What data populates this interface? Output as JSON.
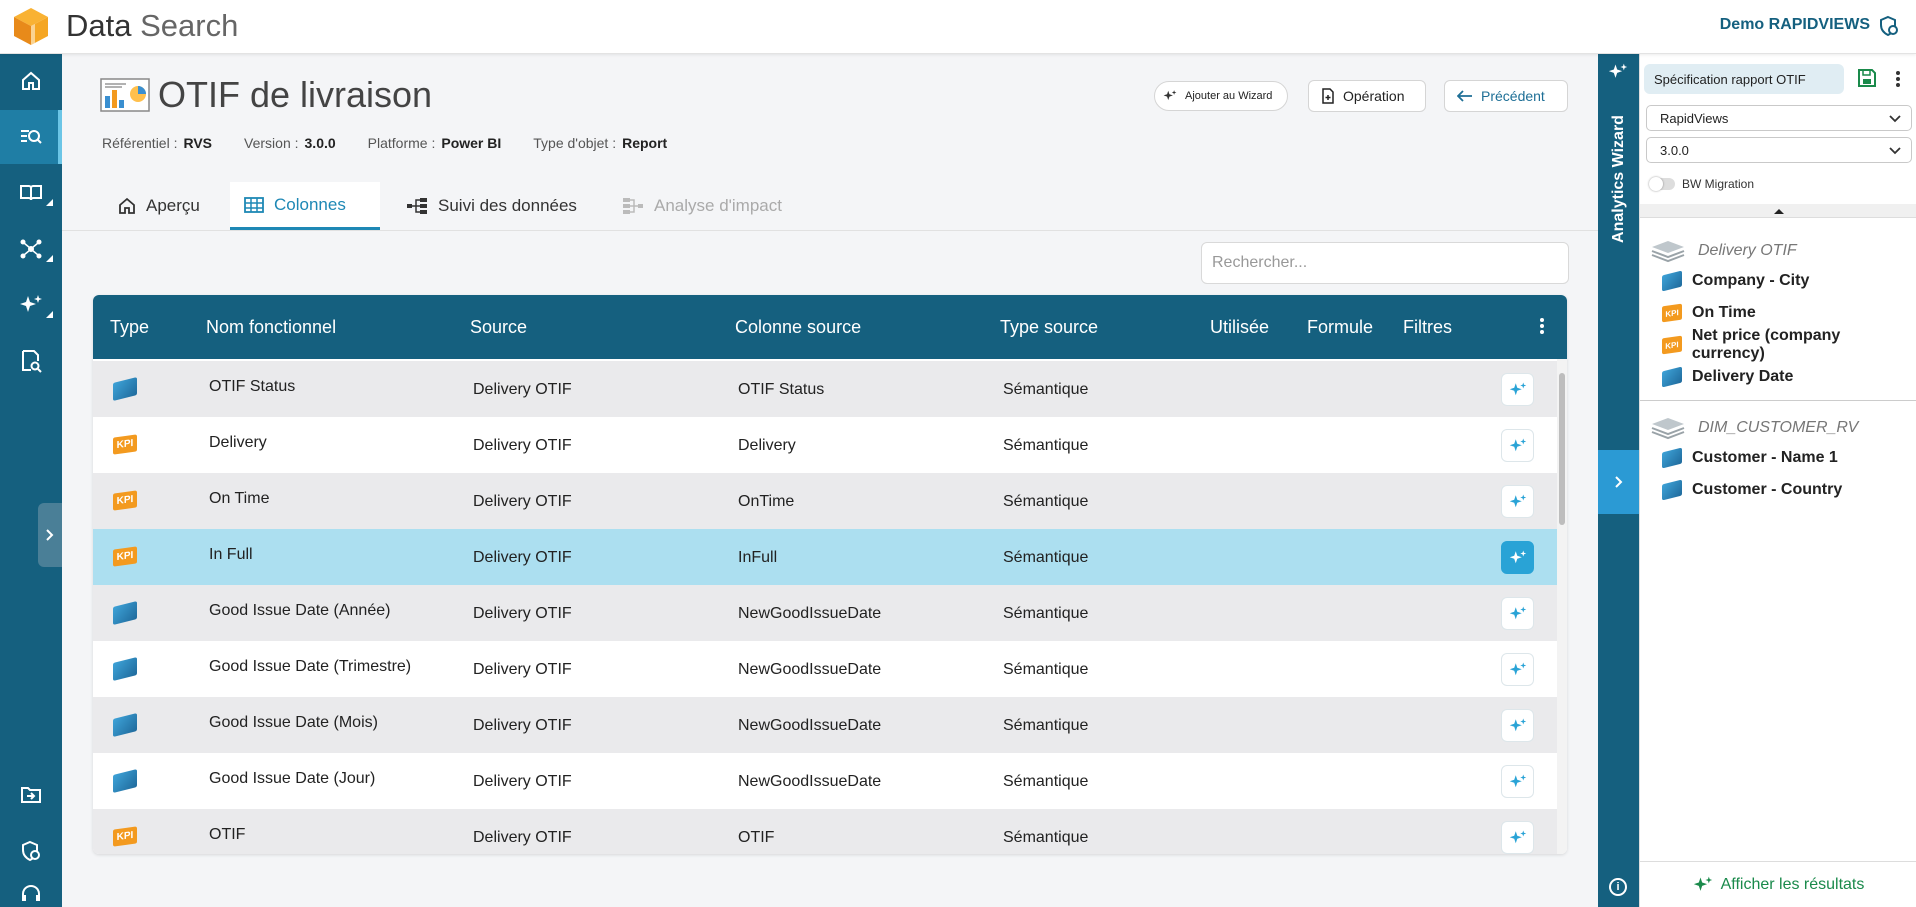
{
  "app": {
    "title_part1": "Data",
    "title_part2": "Search",
    "user": "Demo RAPIDVIEWS"
  },
  "nav": {
    "items": [
      "home-icon",
      "search-list-icon",
      "book-icon",
      "network-icon",
      "sparkle-icon",
      "report-search-icon"
    ],
    "bottom_items": [
      "import-icon",
      "shield-user-icon",
      "support-icon"
    ]
  },
  "header": {
    "title": "OTIF de livraison",
    "meta": [
      {
        "label": "Référentiel :",
        "value": "RVS"
      },
      {
        "label": "Version :",
        "value": "3.0.0"
      },
      {
        "label": "Platforme :",
        "value": "Power BI"
      },
      {
        "label": "Type d'objet :",
        "value": "Report"
      }
    ],
    "add_wizard_label": "Ajouter au Wizard",
    "operation_label": "Opération",
    "prev_label": "Précédent"
  },
  "tabs": [
    {
      "label": "Aperçu",
      "icon": "home-icon",
      "state": "normal"
    },
    {
      "label": "Colonnes",
      "icon": "table-icon",
      "state": "active"
    },
    {
      "label": "Suivi des données",
      "icon": "lineage-icon",
      "state": "normal"
    },
    {
      "label": "Analyse d'impact",
      "icon": "impact-icon",
      "state": "disabled"
    }
  ],
  "search": {
    "placeholder": "Rechercher..."
  },
  "table": {
    "headers": {
      "type": "Type",
      "name": "Nom fonctionnel",
      "source": "Source",
      "column": "Colonne source",
      "type_source": "Type source",
      "used": "Utilisée",
      "formula": "Formule",
      "filters": "Filtres"
    },
    "rows": [
      {
        "type": "dimension",
        "name": "OTIF Status",
        "source": "Delivery OTIF",
        "column": "OTIF Status",
        "type_source": "Sémantique"
      },
      {
        "type": "kpi",
        "name": "Delivery",
        "source": "Delivery OTIF",
        "column": "Delivery",
        "type_source": "Sémantique"
      },
      {
        "type": "kpi",
        "name": "On Time",
        "source": "Delivery OTIF",
        "column": "OnTime",
        "type_source": "Sémantique"
      },
      {
        "type": "kpi",
        "name": "In Full",
        "source": "Delivery OTIF",
        "column": "InFull",
        "type_source": "Sémantique",
        "selected": true
      },
      {
        "type": "dimension",
        "name": "Good Issue Date (Année)",
        "source": "Delivery OTIF",
        "column": "NewGoodIssueDate",
        "type_source": "Sémantique"
      },
      {
        "type": "dimension",
        "name": "Good Issue Date (Trimestre)",
        "source": "Delivery OTIF",
        "column": "NewGoodIssueDate",
        "type_source": "Sémantique"
      },
      {
        "type": "dimension",
        "name": "Good Issue Date (Mois)",
        "source": "Delivery OTIF",
        "column": "NewGoodIssueDate",
        "type_source": "Sémantique"
      },
      {
        "type": "dimension",
        "name": "Good Issue Date (Jour)",
        "source": "Delivery OTIF",
        "column": "NewGoodIssueDate",
        "type_source": "Sémantique"
      },
      {
        "type": "kpi",
        "name": "OTIF",
        "source": "Delivery OTIF",
        "column": "OTIF",
        "type_source": "Sémantique"
      }
    ],
    "kpi_badge": "KPI"
  },
  "wizard": {
    "strip_label": "Analytics Wizard",
    "spec_label": "Spécification rapport OTIF",
    "select1": "RapidViews",
    "select2": "3.0.0",
    "toggle_label": "BW Migration",
    "groups": [
      {
        "name": "Delivery OTIF",
        "fields": [
          {
            "name": "Company - City",
            "type": "dimension"
          },
          {
            "name": "On Time",
            "type": "kpi"
          },
          {
            "name": "Net price (company currency)",
            "type": "kpi"
          },
          {
            "name": "Delivery Date",
            "type": "dimension"
          }
        ]
      },
      {
        "name": "DIM_CUSTOMER_RV",
        "fields": [
          {
            "name": "Customer - Name 1",
            "type": "dimension"
          },
          {
            "name": "Customer - Country",
            "type": "dimension"
          }
        ]
      }
    ],
    "show_results_label": "Afficher les résultats"
  },
  "colors": {
    "nav_bg": "#15607f",
    "accent": "#1e88b5",
    "selected_row": "#acdff0",
    "kpi": "#f39a1f",
    "success": "#1a8a4b"
  }
}
